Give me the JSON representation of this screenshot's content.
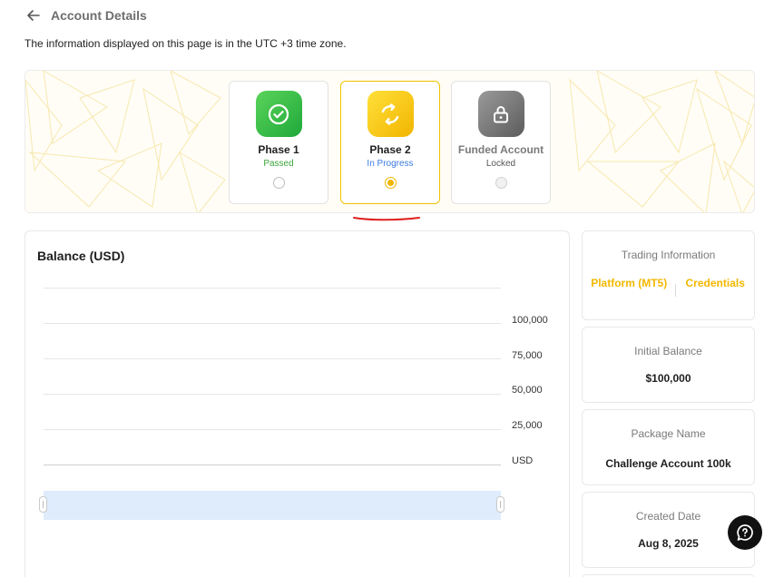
{
  "header": {
    "title": "Account Details",
    "back_icon": "arrow-left-icon"
  },
  "timezone_note": "The information displayed on this page is in the UTC +3 time zone.",
  "phases": [
    {
      "name": "Phase 1",
      "status": "Passed",
      "icon": "check-circle-icon",
      "status_color": "#3aa63a",
      "selected": false
    },
    {
      "name": "Phase 2",
      "status": "In Progress",
      "icon": "refresh-icon",
      "status_color": "#3b7be0",
      "selected": true
    },
    {
      "name": "Funded Account",
      "status": "Locked",
      "icon": "lock-icon",
      "status_color": "#555555",
      "selected": false
    }
  ],
  "balance": {
    "title": "Balance (USD)",
    "y_ticks": [
      "100,000",
      "75,000",
      "50,000",
      "25,000",
      "USD"
    ]
  },
  "trading_info": {
    "label": "Trading Information",
    "links": [
      "Platform (MT5)",
      "Credentials"
    ]
  },
  "initial_balance": {
    "label": "Initial Balance",
    "value": "$100,000"
  },
  "package": {
    "label": "Package Name",
    "value": "Challenge Account 100k"
  },
  "created": {
    "label": "Created Date",
    "value": "Aug 8, 2025"
  },
  "colors": {
    "accent": "#f2b800",
    "passed": "#3aa63a",
    "in_progress": "#3b7be0"
  },
  "support_icon": "chat-help-icon"
}
